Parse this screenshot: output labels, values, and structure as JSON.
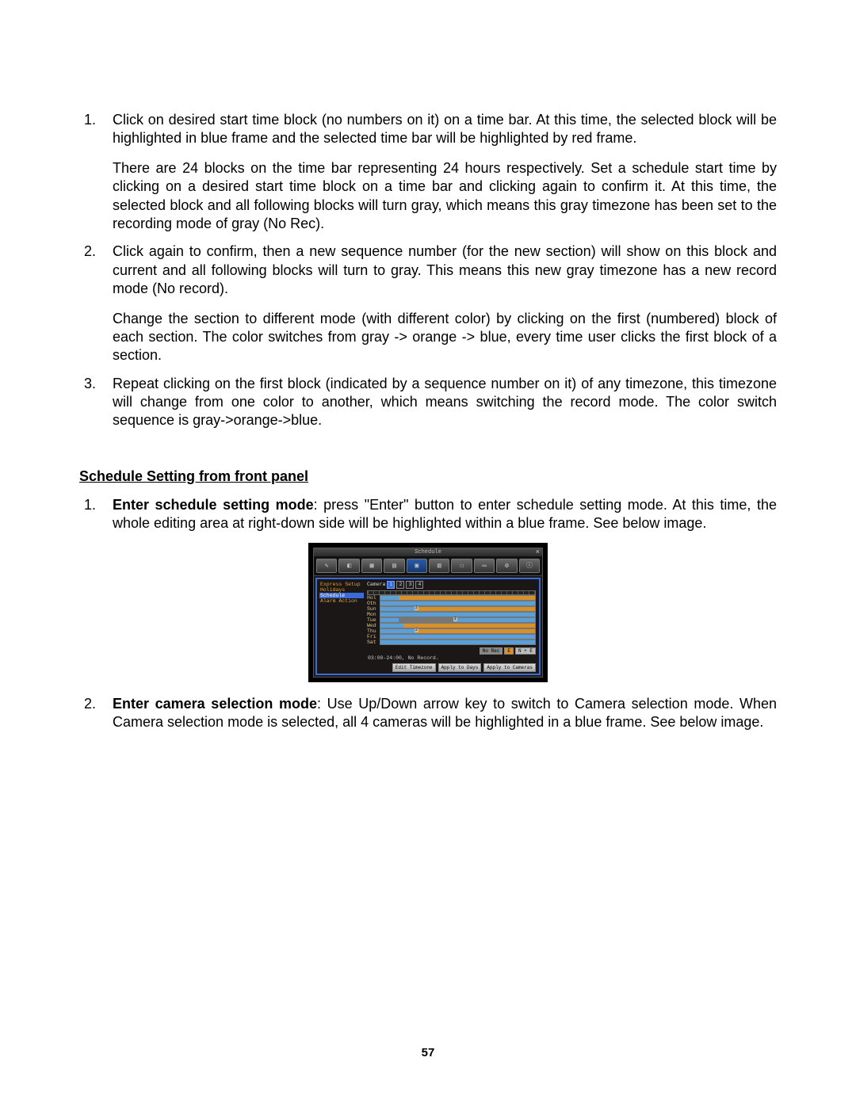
{
  "list1": {
    "i1": {
      "num": "1.",
      "p1": "Click on desired start time block (no numbers on it) on a time bar. At this time, the selected block will be highlighted in blue frame and the selected time bar will be highlighted by red frame.",
      "p2": "There are 24 blocks on the time bar representing 24 hours respectively. Set a schedule start time by clicking on a desired start time block on a time bar and clicking again to confirm it. At this time, the selected block and all following blocks will turn gray, which means this gray timezone has been set to the recording mode of gray (No Rec)."
    },
    "i2": {
      "num": "2.",
      "p1": "Click again to confirm, then a new sequence number (for the new section) will show on this block and current and all following blocks will turn to gray. This means this new gray timezone has a new record mode (No record).",
      "p2": "Change the section to different mode (with different color) by clicking on the first (numbered) block of each section. The color switches from gray -> orange -> blue, every time user clicks the first block of a section."
    },
    "i3": {
      "num": "3.",
      "p1": "Repeat clicking on the first block (indicated by a sequence number on it) of any timezone, this timezone will change from one color to another, which means switching the record mode. The color switch sequence is gray->orange->blue."
    }
  },
  "heading2": "Schedule Setting from front panel",
  "list2": {
    "i1": {
      "num": "1.",
      "bold": "Enter schedule setting mode",
      "rest": ": press \"Enter\" button to enter schedule setting mode. At this time, the whole editing area at right-down side will be highlighted within a blue frame. See below image."
    },
    "i2": {
      "num": "2.",
      "bold": "Enter camera selection mode",
      "rest": ": Use Up/Down arrow key to switch to Camera selection mode. When Camera selection mode is selected, all 4 cameras will be highlighted in a blue frame. See below image."
    }
  },
  "shot": {
    "title": "Schedule",
    "close": "×",
    "sidebar": {
      "s1": "Express Setup",
      "s2": "Holidays",
      "s3": "Schedule",
      "s4": "Alarm Action"
    },
    "camera_label": "Camera",
    "cam": {
      "c1": "1",
      "c2": "2",
      "c3": "3",
      "c4": "4"
    },
    "days": {
      "d0": "Hol",
      "d1": "Oth",
      "d2": "Sun",
      "d3": "Mon",
      "d4": "Tue",
      "d5": "Wed",
      "d6": "Thu",
      "d7": "Fri",
      "d8": "Sat"
    },
    "legend": {
      "norec": "No Rec",
      "e": "E",
      "ne": "N + E"
    },
    "status": "03:00-24:00, No Record.",
    "buttons": {
      "b1": "Edit Timezone",
      "b2": "Apply to Days",
      "b3": "Apply to Cameras"
    }
  },
  "page_number": "57"
}
